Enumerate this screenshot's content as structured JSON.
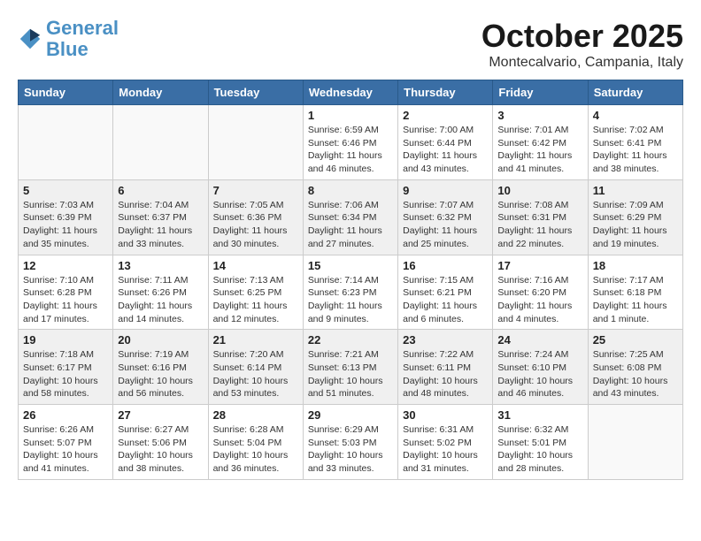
{
  "header": {
    "logo_line1": "General",
    "logo_line2": "Blue",
    "month": "October 2025",
    "location": "Montecalvario, Campania, Italy"
  },
  "weekdays": [
    "Sunday",
    "Monday",
    "Tuesday",
    "Wednesday",
    "Thursday",
    "Friday",
    "Saturday"
  ],
  "weeks": [
    [
      {
        "day": "",
        "info": ""
      },
      {
        "day": "",
        "info": ""
      },
      {
        "day": "",
        "info": ""
      },
      {
        "day": "1",
        "info": "Sunrise: 6:59 AM\nSunset: 6:46 PM\nDaylight: 11 hours\nand 46 minutes."
      },
      {
        "day": "2",
        "info": "Sunrise: 7:00 AM\nSunset: 6:44 PM\nDaylight: 11 hours\nand 43 minutes."
      },
      {
        "day": "3",
        "info": "Sunrise: 7:01 AM\nSunset: 6:42 PM\nDaylight: 11 hours\nand 41 minutes."
      },
      {
        "day": "4",
        "info": "Sunrise: 7:02 AM\nSunset: 6:41 PM\nDaylight: 11 hours\nand 38 minutes."
      }
    ],
    [
      {
        "day": "5",
        "info": "Sunrise: 7:03 AM\nSunset: 6:39 PM\nDaylight: 11 hours\nand 35 minutes."
      },
      {
        "day": "6",
        "info": "Sunrise: 7:04 AM\nSunset: 6:37 PM\nDaylight: 11 hours\nand 33 minutes."
      },
      {
        "day": "7",
        "info": "Sunrise: 7:05 AM\nSunset: 6:36 PM\nDaylight: 11 hours\nand 30 minutes."
      },
      {
        "day": "8",
        "info": "Sunrise: 7:06 AM\nSunset: 6:34 PM\nDaylight: 11 hours\nand 27 minutes."
      },
      {
        "day": "9",
        "info": "Sunrise: 7:07 AM\nSunset: 6:32 PM\nDaylight: 11 hours\nand 25 minutes."
      },
      {
        "day": "10",
        "info": "Sunrise: 7:08 AM\nSunset: 6:31 PM\nDaylight: 11 hours\nand 22 minutes."
      },
      {
        "day": "11",
        "info": "Sunrise: 7:09 AM\nSunset: 6:29 PM\nDaylight: 11 hours\nand 19 minutes."
      }
    ],
    [
      {
        "day": "12",
        "info": "Sunrise: 7:10 AM\nSunset: 6:28 PM\nDaylight: 11 hours\nand 17 minutes."
      },
      {
        "day": "13",
        "info": "Sunrise: 7:11 AM\nSunset: 6:26 PM\nDaylight: 11 hours\nand 14 minutes."
      },
      {
        "day": "14",
        "info": "Sunrise: 7:13 AM\nSunset: 6:25 PM\nDaylight: 11 hours\nand 12 minutes."
      },
      {
        "day": "15",
        "info": "Sunrise: 7:14 AM\nSunset: 6:23 PM\nDaylight: 11 hours\nand 9 minutes."
      },
      {
        "day": "16",
        "info": "Sunrise: 7:15 AM\nSunset: 6:21 PM\nDaylight: 11 hours\nand 6 minutes."
      },
      {
        "day": "17",
        "info": "Sunrise: 7:16 AM\nSunset: 6:20 PM\nDaylight: 11 hours\nand 4 minutes."
      },
      {
        "day": "18",
        "info": "Sunrise: 7:17 AM\nSunset: 6:18 PM\nDaylight: 11 hours\nand 1 minute."
      }
    ],
    [
      {
        "day": "19",
        "info": "Sunrise: 7:18 AM\nSunset: 6:17 PM\nDaylight: 10 hours\nand 58 minutes."
      },
      {
        "day": "20",
        "info": "Sunrise: 7:19 AM\nSunset: 6:16 PM\nDaylight: 10 hours\nand 56 minutes."
      },
      {
        "day": "21",
        "info": "Sunrise: 7:20 AM\nSunset: 6:14 PM\nDaylight: 10 hours\nand 53 minutes."
      },
      {
        "day": "22",
        "info": "Sunrise: 7:21 AM\nSunset: 6:13 PM\nDaylight: 10 hours\nand 51 minutes."
      },
      {
        "day": "23",
        "info": "Sunrise: 7:22 AM\nSunset: 6:11 PM\nDaylight: 10 hours\nand 48 minutes."
      },
      {
        "day": "24",
        "info": "Sunrise: 7:24 AM\nSunset: 6:10 PM\nDaylight: 10 hours\nand 46 minutes."
      },
      {
        "day": "25",
        "info": "Sunrise: 7:25 AM\nSunset: 6:08 PM\nDaylight: 10 hours\nand 43 minutes."
      }
    ],
    [
      {
        "day": "26",
        "info": "Sunrise: 6:26 AM\nSunset: 5:07 PM\nDaylight: 10 hours\nand 41 minutes."
      },
      {
        "day": "27",
        "info": "Sunrise: 6:27 AM\nSunset: 5:06 PM\nDaylight: 10 hours\nand 38 minutes."
      },
      {
        "day": "28",
        "info": "Sunrise: 6:28 AM\nSunset: 5:04 PM\nDaylight: 10 hours\nand 36 minutes."
      },
      {
        "day": "29",
        "info": "Sunrise: 6:29 AM\nSunset: 5:03 PM\nDaylight: 10 hours\nand 33 minutes."
      },
      {
        "day": "30",
        "info": "Sunrise: 6:31 AM\nSunset: 5:02 PM\nDaylight: 10 hours\nand 31 minutes."
      },
      {
        "day": "31",
        "info": "Sunrise: 6:32 AM\nSunset: 5:01 PM\nDaylight: 10 hours\nand 28 minutes."
      },
      {
        "day": "",
        "info": ""
      }
    ]
  ]
}
